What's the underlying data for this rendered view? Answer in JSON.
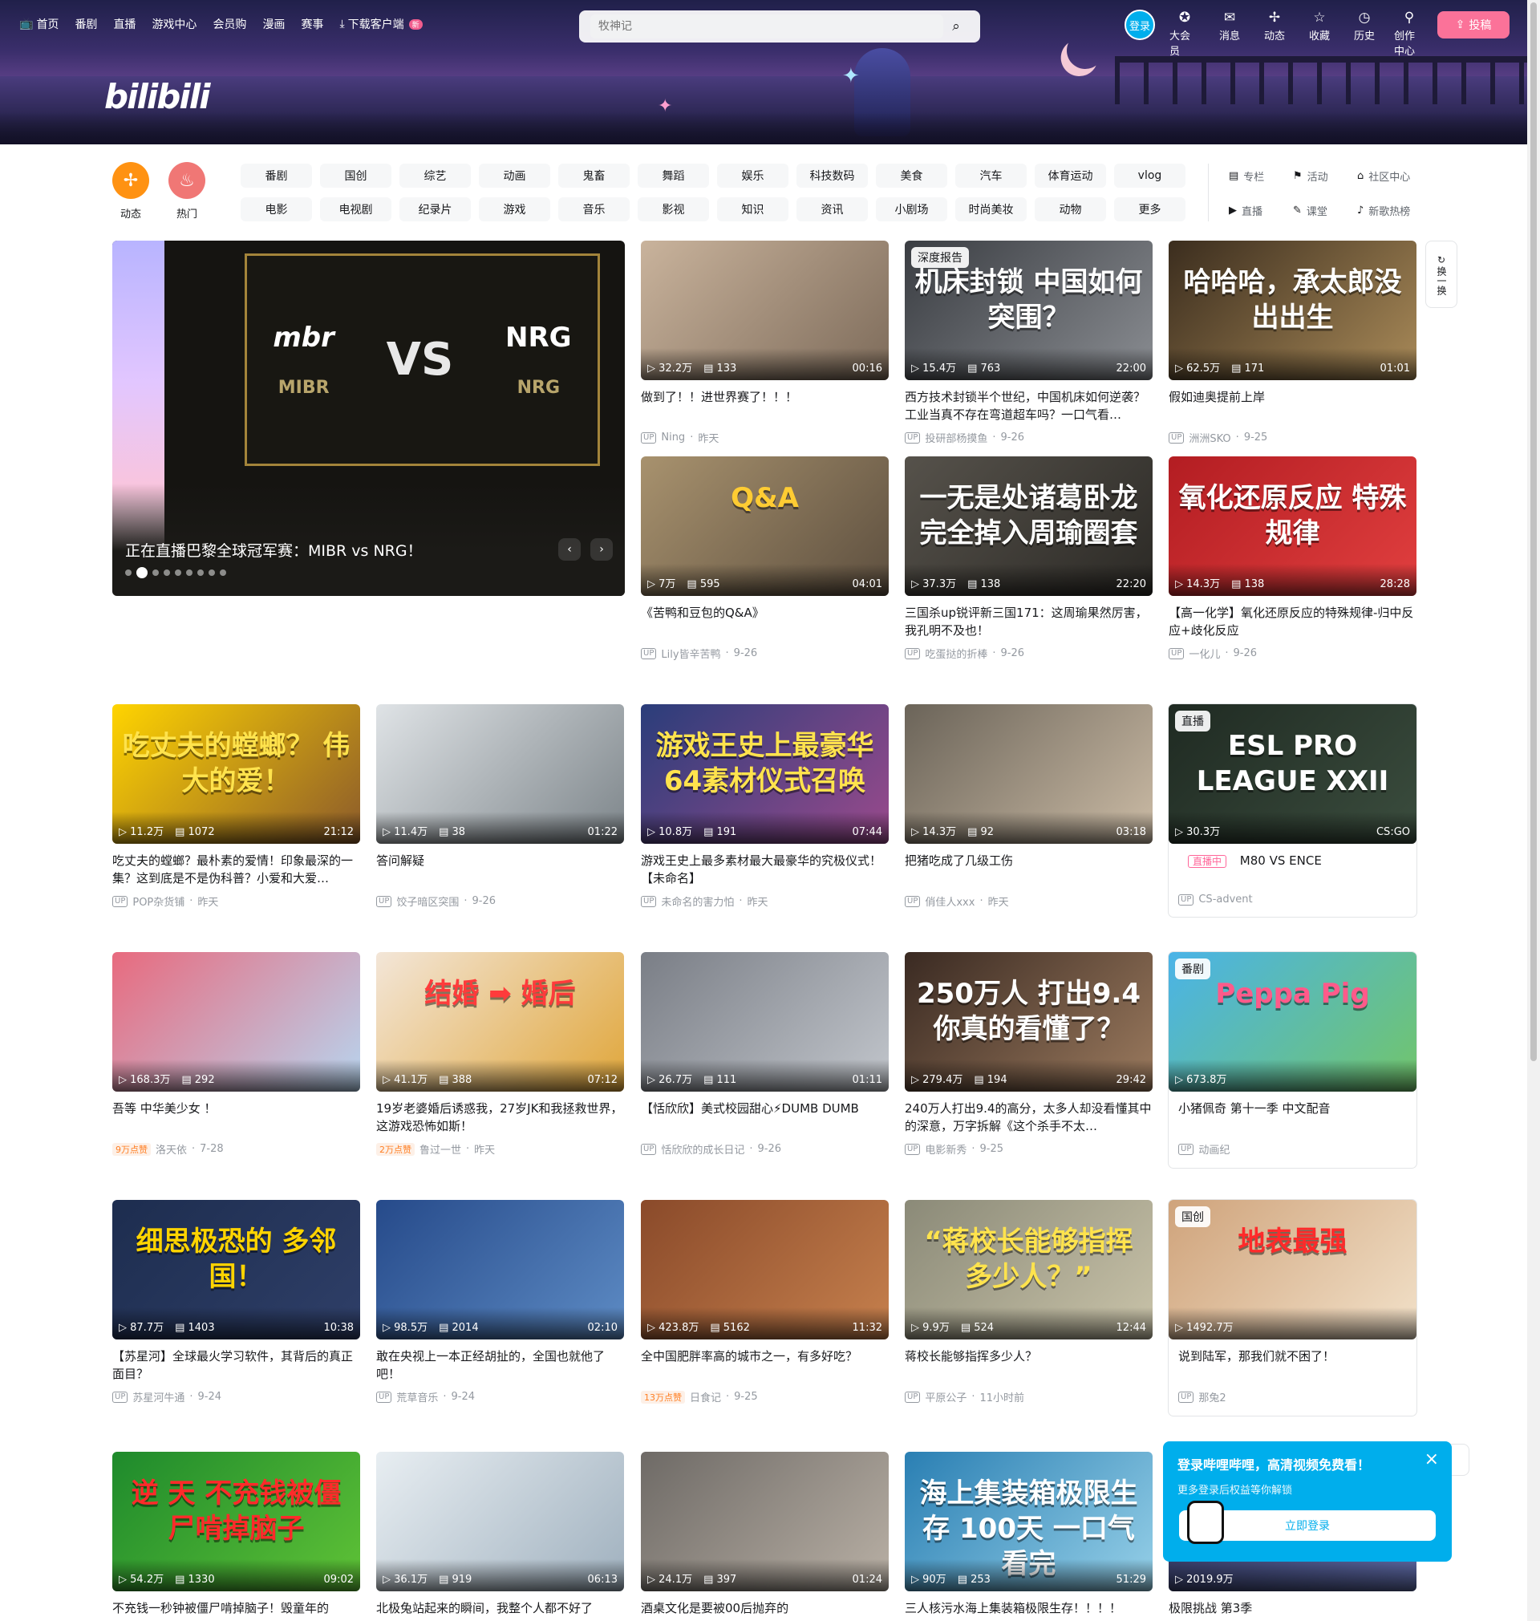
{
  "topnav": {
    "items": [
      "首页",
      "番剧",
      "直播",
      "游戏中心",
      "会员购",
      "漫画",
      "赛事",
      "下载客户端"
    ],
    "new_badge": "新"
  },
  "search": {
    "placeholder": "牧神记"
  },
  "user": {
    "login": "登录",
    "items": [
      "大会员",
      "消息",
      "动态",
      "收藏",
      "历史",
      "创作中心"
    ],
    "upload": "投稿"
  },
  "logo": "bilibili",
  "channels": {
    "dynamic": "动态",
    "hot": "热门",
    "chips": [
      "番剧",
      "国创",
      "综艺",
      "动画",
      "鬼畜",
      "舞蹈",
      "娱乐",
      "科技数码",
      "美食",
      "汽车",
      "体育运动",
      "vlog",
      "电影",
      "电视剧",
      "纪录片",
      "游戏",
      "音乐",
      "影视",
      "知识",
      "资讯",
      "小剧场",
      "时尚美妆",
      "动物",
      "更多"
    ],
    "links": [
      "专栏",
      "活动",
      "社区中心",
      "直播",
      "课堂",
      "新歌热榜"
    ]
  },
  "carousel": {
    "caption": "正在直播巴黎全球冠军赛：MIBR vs NRG！",
    "team_a": "mbr",
    "team_a_name": "MIBR",
    "vs": "VS",
    "team_b": "NRG",
    "team_b_name": "NRG",
    "prev": "‹",
    "next": "›"
  },
  "refresh": "换一换",
  "videos": [
    {
      "title": "做到了！！进世界赛了！！！",
      "up": "Ning",
      "date": "昨天",
      "views": "32.2万",
      "danmaku": "133",
      "duration": "00:16",
      "overlay": ""
    },
    {
      "title": "西方技术封锁半个世纪，中国机床如何逆袭？工业当真不存在弯道超车吗？一口气看…",
      "up": "投研部杨摸鱼",
      "date": "9-26",
      "views": "15.4万",
      "danmaku": "763",
      "duration": "22:00",
      "overlay": "机床封锁 中国如何突围？",
      "badge": "深度报告"
    },
    {
      "title": "假如迪奥提前上岸",
      "up": "洲洲SKO",
      "date": "9-25",
      "views": "62.5万",
      "danmaku": "171",
      "duration": "01:01",
      "overlay": "哈哈哈，承太郎没出出生"
    },
    {
      "title": "《苦鸭和豆包的Q&A》",
      "up": "Lily皆辛苦鸭",
      "date": "9-26",
      "views": "7万",
      "danmaku": "595",
      "duration": "04:01",
      "overlay": "Q&A"
    },
    {
      "title": "三国杀up锐评新三国171：这周瑜果然厉害，我孔明不及也！",
      "up": "吃蛋挞的折棒",
      "date": "9-26",
      "views": "37.3万",
      "danmaku": "138",
      "duration": "22:20",
      "overlay": "一无是处诸葛卧龙 完全掉入周瑜圈套"
    },
    {
      "title": "【高一化学】氧化还原反应的特殊规律-归中反应+歧化反应",
      "up": "一化儿",
      "date": "9-26",
      "views": "14.3万",
      "danmaku": "138",
      "duration": "28:28",
      "overlay": "氧化还原反应 特殊规律"
    },
    {
      "title": "吃丈夫的螳螂？最朴素的爱情！印象最深的一集？这到底是不是伪科普？小爱和大爱…",
      "up": "POP杂货铺",
      "date": "昨天",
      "views": "11.2万",
      "danmaku": "1072",
      "duration": "21:12",
      "overlay": "吃丈夫的螳螂？ 伟大的爱！"
    },
    {
      "title": "答问解疑",
      "up": "饺子暗区突围",
      "date": "9-26",
      "views": "11.4万",
      "danmaku": "38",
      "duration": "01:22",
      "overlay": ""
    },
    {
      "title": "游戏王史上最多素材最大最豪华的究极仪式！【未命名】",
      "up": "未命名的害力怕",
      "date": "昨天",
      "views": "10.8万",
      "danmaku": "191",
      "duration": "07:44",
      "overlay": "游戏王史上最豪华 64素材仪式召唤"
    },
    {
      "title": "把猪吃成了几级工伤",
      "up": "俏佳人xxx",
      "date": "昨天",
      "views": "14.3万",
      "danmaku": "92",
      "duration": "03:18",
      "overlay": ""
    },
    {
      "title": "M80 VS ENCE",
      "up": "CS-advent",
      "date": "",
      "views": "30.3万",
      "danmaku": "",
      "duration": "CS:GO",
      "overlay": "ESL PRO LEAGUE XXII",
      "badge": "直播",
      "live": "直播中"
    },
    {
      "title": "吾等 中华美少女 ！",
      "up": "洛天依",
      "date": "7-28",
      "views": "168.3万",
      "danmaku": "292",
      "duration": "",
      "overlay": "",
      "tag": "9万点赞"
    },
    {
      "title": "19岁老婆婚后诱惑我，27岁JK和我拯救世界，这游戏恐怖如斯！",
      "up": "鲁过一世",
      "date": "昨天",
      "views": "41.1万",
      "danmaku": "388",
      "duration": "07:12",
      "overlay": "结婚 ➡ 婚后",
      "tag": "2万点赞"
    },
    {
      "title": "【恬欣欣】美式校园甜心⚡DUMB DUMB",
      "up": "恬欣欣的成长日记",
      "date": "9-26",
      "views": "26.7万",
      "danmaku": "111",
      "duration": "01:11",
      "overlay": ""
    },
    {
      "title": "240万人打出9.4的高分，太多人却没看懂其中的深意，万字拆解《这个杀手不太…",
      "up": "电影新秀",
      "date": "9-25",
      "views": "279.4万",
      "danmaku": "194",
      "duration": "29:42",
      "overlay": "250万人 打出9.4 你真的看懂了？"
    },
    {
      "title": "小猪佩奇 第十一季 中文配音",
      "up": "动画纪",
      "date": "",
      "views": "673.8万",
      "danmaku": "",
      "duration": "",
      "overlay": "Peppa Pig",
      "badge": "番剧"
    },
    {
      "title": "【苏星河】全球最火学习软件，其背后的真正面目？",
      "up": "苏星河牛通",
      "date": "9-24",
      "views": "87.7万",
      "danmaku": "1403",
      "duration": "10:38",
      "overlay": "细思极恐的 多邻国！"
    },
    {
      "title": "敢在央视上一本正经胡扯的，全国也就他了吧！",
      "up": "荒草音乐",
      "date": "9-24",
      "views": "98.5万",
      "danmaku": "2014",
      "duration": "02:10",
      "overlay": ""
    },
    {
      "title": "全中国肥胖率高的城市之一，有多好吃？",
      "up": "日食记",
      "date": "9-25",
      "views": "423.8万",
      "danmaku": "5162",
      "duration": "11:32",
      "overlay": "",
      "tag": "13万点赞"
    },
    {
      "title": "蒋校长能够指挥多少人？",
      "up": "平原公子",
      "date": "11小时前",
      "views": "9.9万",
      "danmaku": "524",
      "duration": "12:44",
      "overlay": "“蒋校长能够指挥 多少人？”"
    },
    {
      "title": "说到陆军，那我们就不困了！",
      "up": "那兔2",
      "date": "",
      "views": "1492.7万",
      "danmaku": "",
      "duration": "",
      "overlay": "地表最强",
      "badge": "国创"
    },
    {
      "title": "不充钱一秒钟被僵尸啃掉脑子！毁童年的",
      "up": "",
      "date": "",
      "views": "54.2万",
      "danmaku": "1330",
      "duration": "09:02",
      "overlay": "逆 天 不充钱被僵尸啃掉脑子"
    },
    {
      "title": "北极兔站起来的瞬间，我整个人都不好了",
      "up": "",
      "date": "",
      "views": "36.1万",
      "danmaku": "919",
      "duration": "06:13",
      "overlay": ""
    },
    {
      "title": "酒桌文化是要被00后抛弃的",
      "up": "",
      "date": "",
      "views": "24.1万",
      "danmaku": "397",
      "duration": "01:24",
      "overlay": ""
    },
    {
      "title": "三人核污水海上集装箱极限生存！！！！",
      "up": "",
      "date": "",
      "views": "90万",
      "danmaku": "253",
      "duration": "51:29",
      "overlay": "海上集装箱极限生存 100天 一口气看完"
    },
    {
      "title": "极限挑战 第3季",
      "up": "",
      "date": "",
      "views": "2019.9万",
      "danmaku": "",
      "duration": "",
      "overlay": ""
    }
  ],
  "popup": {
    "title": "登录哔哩哔哩，高清视频免费看！",
    "subtitle": "更多登录后权益等你解锁",
    "button": "立即登录",
    "close": "×"
  },
  "colors": {
    "brand_pink": "#fb7299",
    "brand_blue": "#00aeec",
    "orange": "#ff7f24"
  }
}
